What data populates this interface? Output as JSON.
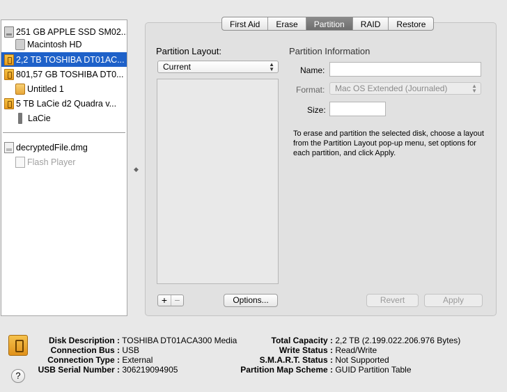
{
  "sidebar": {
    "items": [
      {
        "label": "251 GB APPLE SSD SM02...",
        "icon": "internal-disk-icon"
      },
      {
        "label": "Macintosh HD",
        "icon": "volume-icon"
      },
      {
        "label": "2,2 TB TOSHIBA DT01AC...",
        "icon": "usb-disk-icon",
        "selected": true
      },
      {
        "label": "801,57 GB TOSHIBA DT0...",
        "icon": "usb-disk-icon"
      },
      {
        "label": "Untitled 1",
        "icon": "volume-icon"
      },
      {
        "label": "5 TB LaCie d2 Quadra v...",
        "icon": "usb-disk-icon"
      },
      {
        "label": "LaCie",
        "icon": "volume-icon"
      },
      {
        "label": "decryptedFile.dmg",
        "icon": "disk-image-icon"
      },
      {
        "label": "Flash Player",
        "icon": "volume-icon"
      }
    ]
  },
  "tabs": [
    "First Aid",
    "Erase",
    "Partition",
    "RAID",
    "Restore"
  ],
  "active_tab": "Partition",
  "partition": {
    "layout_label": "Partition Layout:",
    "layout_value": "Current",
    "info_heading": "Partition Information",
    "name_label": "Name:",
    "name_value": "",
    "format_label": "Format:",
    "format_value": "Mac OS Extended (Journaled)",
    "size_label": "Size:",
    "size_value": "",
    "info_text": "To erase and partition the selected disk, choose a layout from the Partition Layout pop-up menu, set options for each partition, and click Apply.",
    "plus": "+",
    "minus": "−",
    "options_button": "Options...",
    "revert_button": "Revert",
    "apply_button": "Apply"
  },
  "disk_info": {
    "left": [
      {
        "key": "Disk Description :",
        "value": "TOSHIBA DT01ACA300 Media"
      },
      {
        "key": "Connection Bus :",
        "value": "USB"
      },
      {
        "key": "Connection Type :",
        "value": "External"
      },
      {
        "key": "USB Serial Number :",
        "value": "306219094905"
      }
    ],
    "right": [
      {
        "key": "Total Capacity :",
        "value": "2,2 TB (2.199.022.206.976 Bytes)"
      },
      {
        "key": "Write Status :",
        "value": "Read/Write"
      },
      {
        "key": "S.M.A.R.T. Status :",
        "value": "Not Supported"
      },
      {
        "key": "Partition Map Scheme :",
        "value": "GUID Partition Table"
      }
    ]
  },
  "help": "?",
  "colors": {
    "selection": "#1e61c9",
    "panel": "#e1e1e1"
  }
}
